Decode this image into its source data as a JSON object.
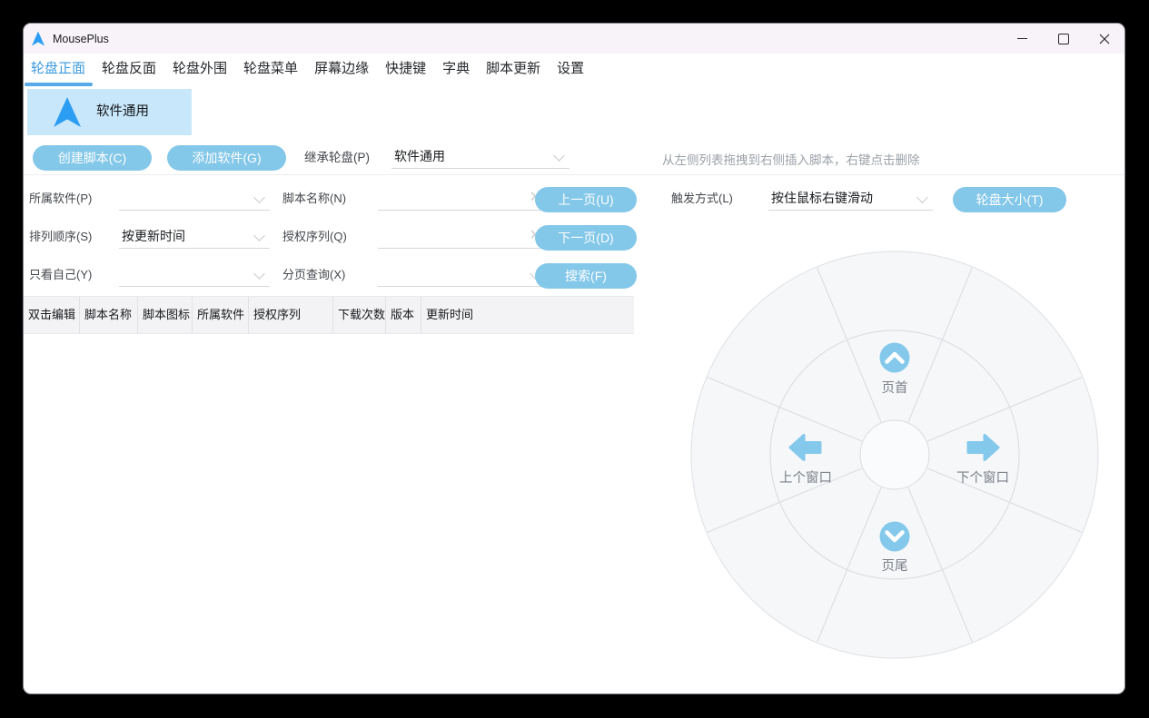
{
  "window": {
    "title": "MousePlus"
  },
  "tabs": [
    {
      "label": "轮盘正面",
      "active": true
    },
    {
      "label": "轮盘反面",
      "active": false
    },
    {
      "label": "轮盘外围",
      "active": false
    },
    {
      "label": "轮盘菜单",
      "active": false
    },
    {
      "label": "屏幕边缘",
      "active": false
    },
    {
      "label": "快捷键",
      "active": false
    },
    {
      "label": "字典",
      "active": false
    },
    {
      "label": "脚本更新",
      "active": false
    },
    {
      "label": "设置",
      "active": false
    }
  ],
  "software_tab": {
    "label": "软件通用"
  },
  "toolbar": {
    "create_script_label": "创建脚本(C)",
    "add_software_label": "添加软件(G)",
    "inherit_label": "继承轮盘(P)",
    "inherit_value": "软件通用",
    "hint": "从左侧列表拖拽到右侧插入脚本，右键点击删除"
  },
  "filters": {
    "own_software": {
      "label": "所属软件(P)",
      "value": ""
    },
    "sort_order": {
      "label": "排列顺序(S)",
      "value": "按更新时间"
    },
    "only_mine": {
      "label": "只看自己(Y)",
      "value": ""
    },
    "script_name": {
      "label": "脚本名称(N)",
      "value": ""
    },
    "auth_serial": {
      "label": "授权序列(Q)",
      "value": ""
    },
    "page_query": {
      "label": "分页查询(X)",
      "value": ""
    },
    "prev_page_label": "上一页(U)",
    "next_page_label": "下一页(D)",
    "search_label": "搜索(F)",
    "trigger_mode": {
      "label": "触发方式(L)",
      "value": "按住鼠标右键滑动"
    },
    "wheel_size_label": "轮盘大小(T)"
  },
  "table": {
    "columns": [
      "双击编辑",
      "脚本名称",
      "脚本图标",
      "所属软件",
      "授权序列",
      "下载次数",
      "版本",
      "更新时间"
    ]
  },
  "wheel": {
    "top": {
      "icon": "chevron-up-circle",
      "label": "页首"
    },
    "left": {
      "icon": "arrow-left",
      "label": "上个窗口"
    },
    "right": {
      "icon": "arrow-right",
      "label": "下个窗口"
    },
    "bottom": {
      "icon": "chevron-down-circle",
      "label": "页尾"
    }
  },
  "colors": {
    "accent_blue": "#3b9ae0",
    "button_blue": "#83c7e9",
    "icon_blue": "#84c9eb",
    "software_tab_bg": "#c9e7fa",
    "logo_blue": "#2b9df3",
    "hint_gray": "#9ba1a8",
    "wheel_bg": "#f6f7f9",
    "wheel_line": "#dcdfe2",
    "wheel_label_gray": "#7b8187",
    "titlebar_bg": "#f8f3f9"
  }
}
